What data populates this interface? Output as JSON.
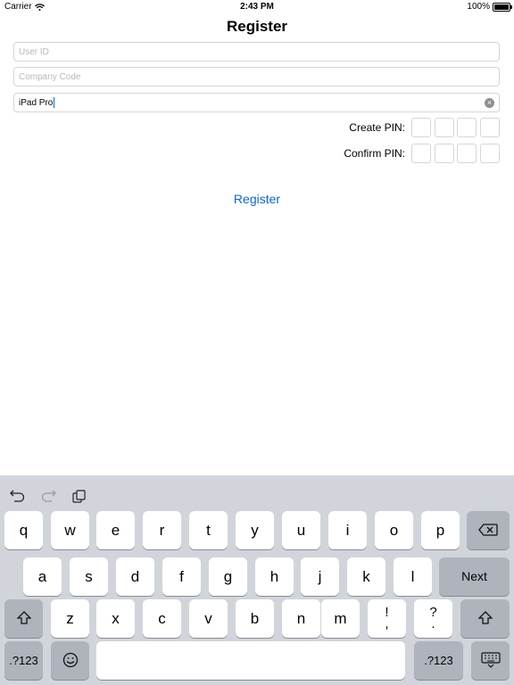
{
  "status_bar": {
    "carrier": "Carrier",
    "time": "2:43 PM",
    "battery_text": "100%",
    "battery_level": 1.0
  },
  "screen": {
    "title": "Register",
    "fields": {
      "user_id": {
        "placeholder": "User ID",
        "value": ""
      },
      "company_code": {
        "placeholder": "Company Code",
        "value": ""
      },
      "device_name": {
        "value": "iPad Pro"
      }
    },
    "pins": {
      "create_label": "Create PIN:",
      "confirm_label": "Confirm PIN:"
    },
    "register_label": "Register"
  },
  "keyboard": {
    "row1": [
      "q",
      "w",
      "e",
      "r",
      "t",
      "y",
      "u",
      "i",
      "o",
      "p"
    ],
    "row2": [
      "a",
      "s",
      "d",
      "f",
      "g",
      "h",
      "j",
      "k",
      "l"
    ],
    "row3": [
      "z",
      "x",
      "c",
      "v",
      "b",
      "n",
      "m"
    ],
    "punct1": [
      "!",
      ","
    ],
    "punct2": [
      "?",
      "."
    ],
    "next_label": "Next",
    "num_label": ".?123",
    "emoji_icon": "emoji-icon",
    "colors": {
      "background": "#d1d5db",
      "key": "#ffffff",
      "func_key": "#aeb3bc",
      "accent": "#0a67d3"
    }
  }
}
